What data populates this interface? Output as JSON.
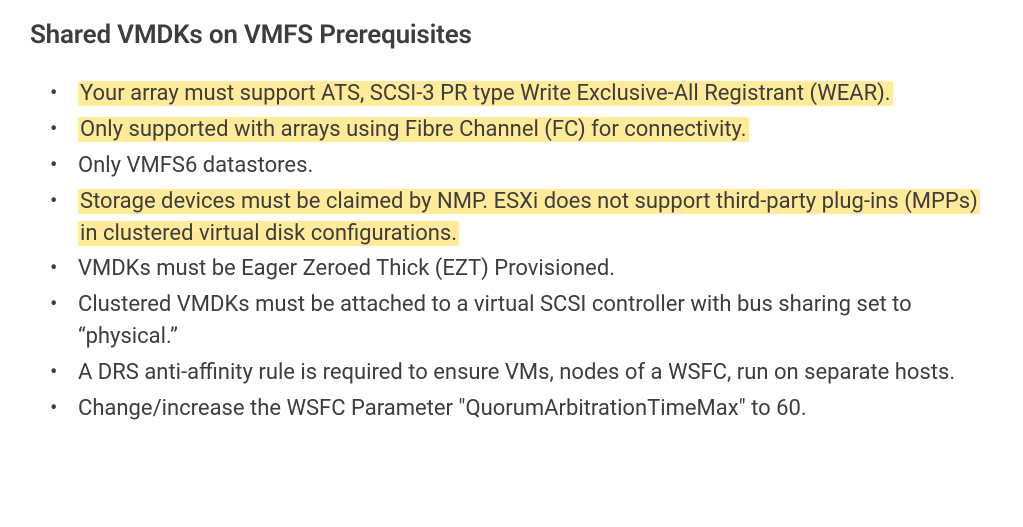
{
  "heading": "Shared VMDKs on VMFS Prerequisites",
  "items": [
    {
      "text": "Your array must support ATS, SCSI-3 PR type Write Exclusive-All Registrant (WEAR).",
      "highlighted": true
    },
    {
      "text": "Only supported with arrays using Fibre Channel (FC) for connectivity.",
      "highlighted": true
    },
    {
      "text": "Only VMFS6 datastores.",
      "highlighted": false
    },
    {
      "text": "Storage devices must be claimed by NMP. ESXi does not support third-party plug-ins (MPPs) in clustered virtual disk configurations.",
      "highlighted": true
    },
    {
      "text": "VMDKs must be Eager Zeroed Thick (EZT) Provisioned.",
      "highlighted": false
    },
    {
      "text": "Clustered VMDKs must be attached to a virtual SCSI controller with bus sharing set to “physical.”",
      "highlighted": false
    },
    {
      "text": "A DRS anti-affinity rule is required to ensure VMs, nodes of a WSFC, run on separate hosts.",
      "highlighted": false
    },
    {
      "text": "Change/increase the WSFC Parameter \"QuorumArbitrationTimeMax\" to 60.",
      "highlighted": false
    }
  ]
}
